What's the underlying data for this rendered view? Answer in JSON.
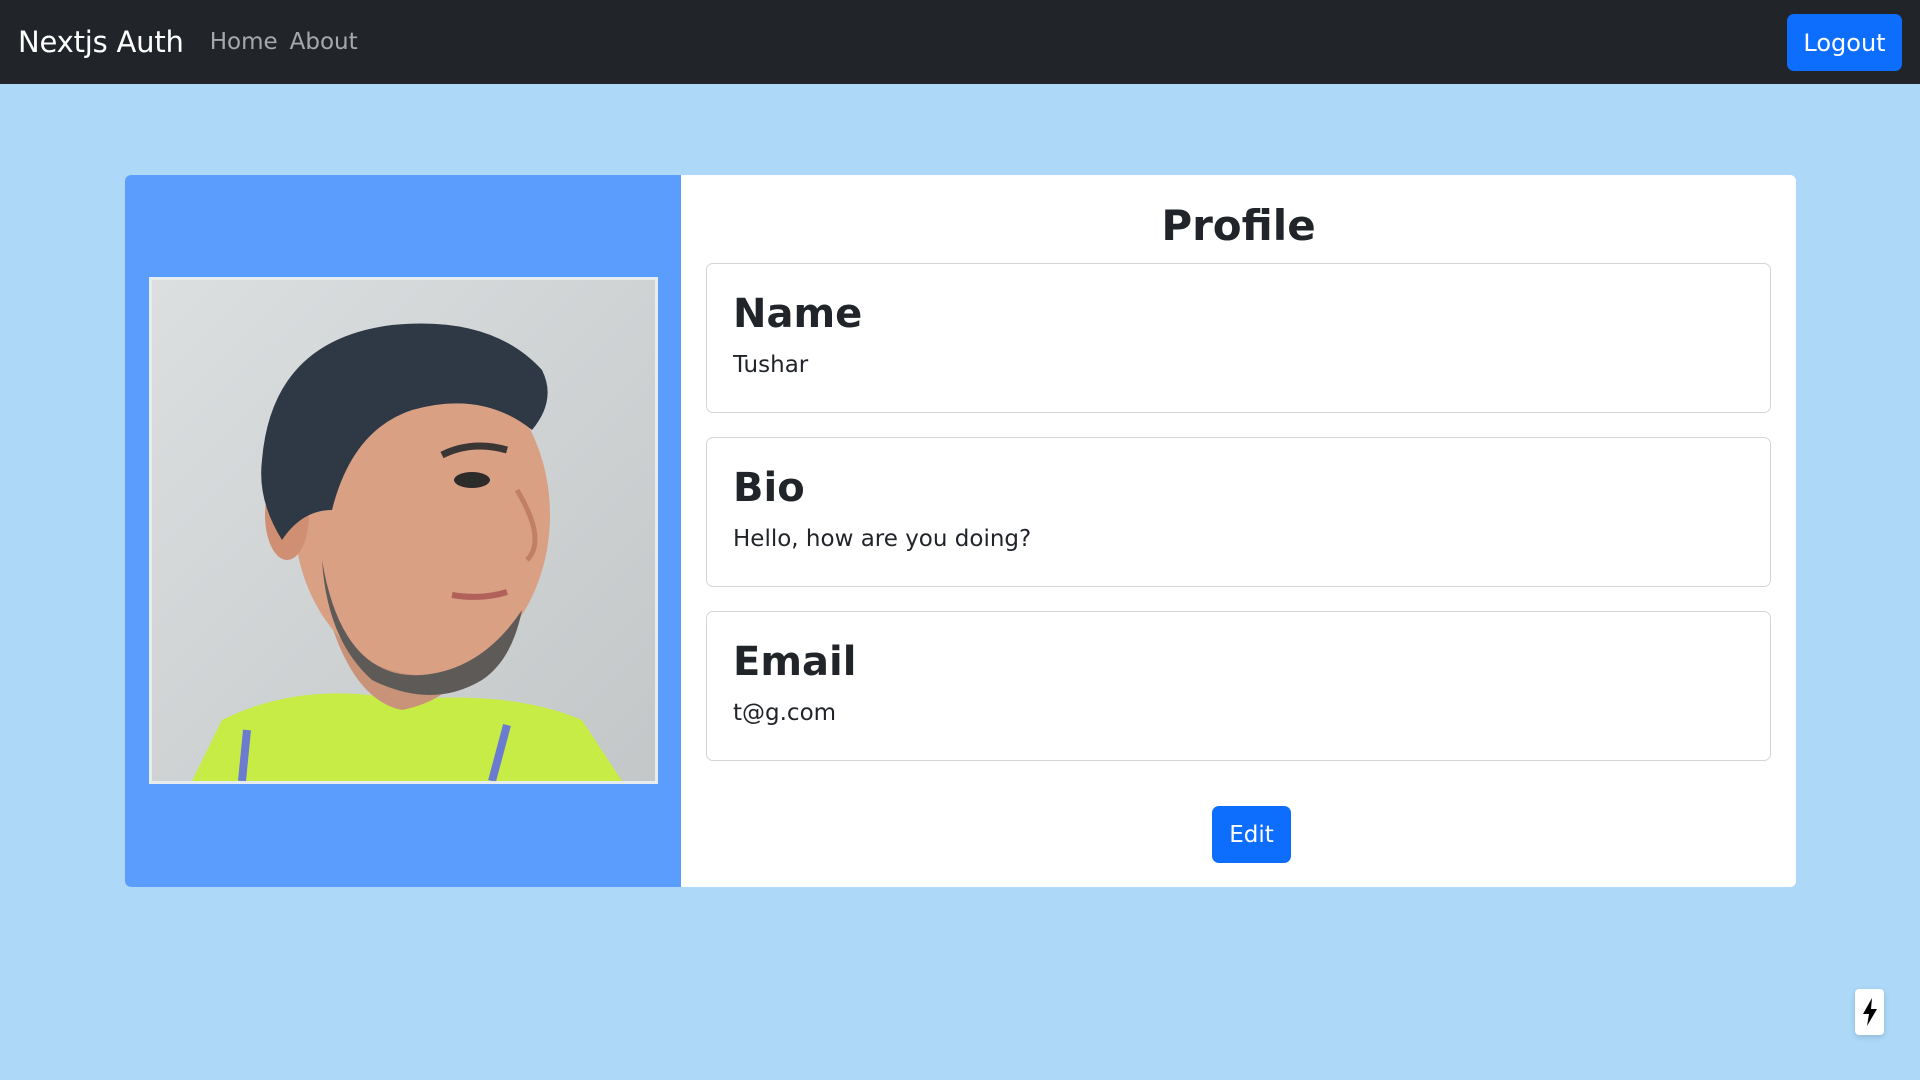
{
  "navbar": {
    "brand": "Nextjs Auth",
    "links": [
      {
        "label": "Home"
      },
      {
        "label": "About"
      }
    ],
    "logout_label": "Logout"
  },
  "profile": {
    "title": "Profile",
    "fields": [
      {
        "heading": "Name",
        "value": "Tushar"
      },
      {
        "heading": "Bio",
        "value": "Hello, how are you doing?"
      },
      {
        "heading": "Email",
        "value": "t@g.com"
      }
    ],
    "edit_label": "Edit",
    "photo": "profile-photo"
  },
  "dev_indicator": {
    "icon": "lightning-bolt-icon"
  },
  "colors": {
    "page_background": "#add8f8",
    "navbar_background": "#212529",
    "primary_button": "#0d6efd",
    "photo_panel": "#5b9dfc"
  }
}
